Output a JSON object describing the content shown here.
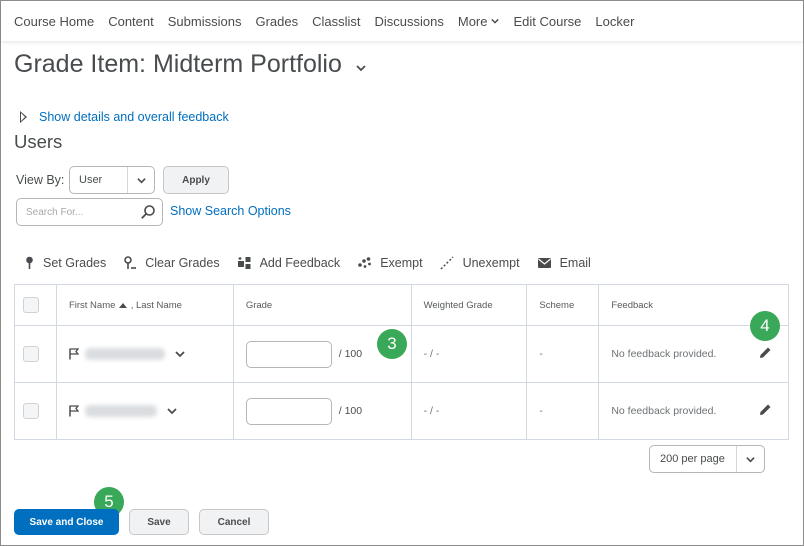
{
  "nav": {
    "items": [
      "Course Home",
      "Content",
      "Submissions",
      "Grades",
      "Classlist",
      "Discussions",
      "More",
      "Edit Course",
      "Locker"
    ]
  },
  "page": {
    "title": "Grade Item: Midterm Portfolio",
    "details_link": "Show details and overall feedback",
    "section_title": "Users"
  },
  "filters": {
    "view_by_label": "View By:",
    "view_by_value": "User",
    "apply_label": "Apply",
    "search_placeholder": "Search For...",
    "search_options_link": "Show Search Options"
  },
  "toolbar": {
    "set_grades": "Set Grades",
    "clear_grades": "Clear Grades",
    "add_feedback": "Add Feedback",
    "exempt": "Exempt",
    "unexempt": "Unexempt",
    "email": "Email"
  },
  "table": {
    "headers": {
      "first_name": "First Name",
      "last_name": ", Last Name",
      "grade": "Grade",
      "weighted_grade": "Weighted Grade",
      "scheme": "Scheme",
      "feedback": "Feedback"
    },
    "rows": [
      {
        "grade_out_of": "/ 100",
        "weighted": "- / -",
        "scheme": "-",
        "feedback": "No feedback provided."
      },
      {
        "grade_out_of": "/ 100",
        "weighted": "- / -",
        "scheme": "-",
        "feedback": "No feedback provided."
      }
    ]
  },
  "pagination": {
    "per_page": "200 per page"
  },
  "actions": {
    "save_close": "Save and Close",
    "save": "Save",
    "cancel": "Cancel"
  },
  "callouts": [
    "3",
    "4",
    "5"
  ],
  "colors": {
    "link": "#006fbf",
    "primary": "#006fbf",
    "callout": "#3aa859",
    "text": "#494c4e"
  }
}
